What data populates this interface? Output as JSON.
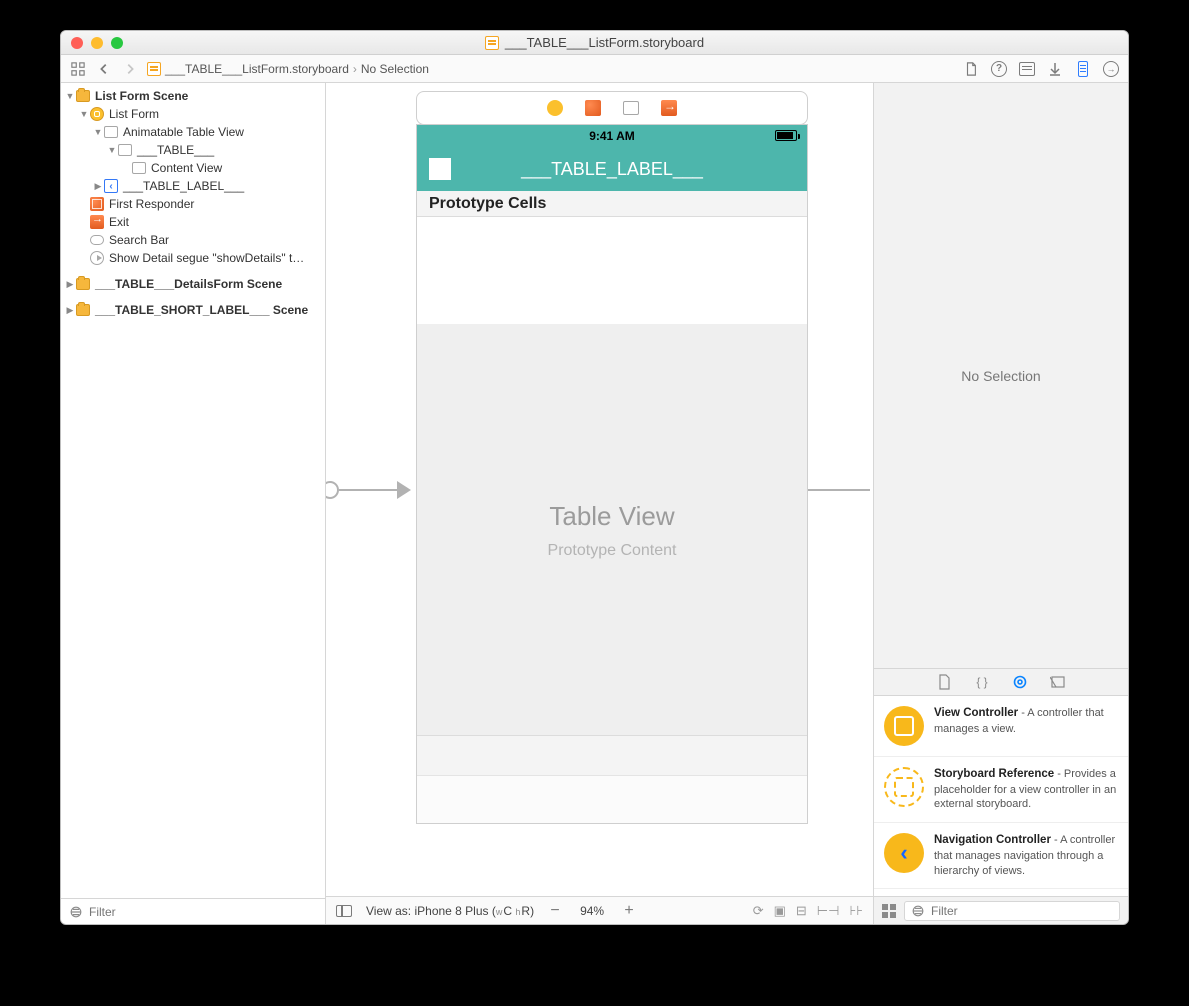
{
  "window_title": "___TABLE___ListForm.storyboard",
  "breadcrumbs": {
    "file": "___TABLE___ListForm.storyboard",
    "selection": "No Selection"
  },
  "outline": {
    "scene1": "List Form Scene",
    "vc": "List Form",
    "atv": "Animatable Table View",
    "table": "___TABLE___",
    "cv": "Content View",
    "tlabel": "___TABLE_LABEL___",
    "fr": "First Responder",
    "exit": "Exit",
    "sb": "Search Bar",
    "segue": "Show Detail segue \"showDetails\" t…",
    "scene2": "___TABLE___DetailsForm Scene",
    "scene3": "___TABLE_SHORT_LABEL___ Scene",
    "filter_placeholder": "Filter"
  },
  "device": {
    "time": "9:41 AM",
    "nav_title": "___TABLE_LABEL___",
    "proto_header": "Prototype Cells",
    "tv_title": "Table View",
    "tv_sub": "Prototype Content"
  },
  "canvas_bottom": {
    "view_as": "View as: iPhone 8 Plus (",
    "w": "w",
    "c": "C",
    "h": "h",
    "r": "R",
    "close": ")",
    "zoom": "94%"
  },
  "inspector": {
    "no_selection": "No Selection",
    "lib": [
      {
        "title": "View Controller",
        "desc": " - A controller that manages a view."
      },
      {
        "title": "Storyboard Reference",
        "desc": " - Provides a placeholder for a view controller in an external storyboard."
      },
      {
        "title": "Navigation Controller",
        "desc": " - A controller that manages navigation through a hierarchy of views."
      }
    ],
    "filter_placeholder": "Filter"
  }
}
